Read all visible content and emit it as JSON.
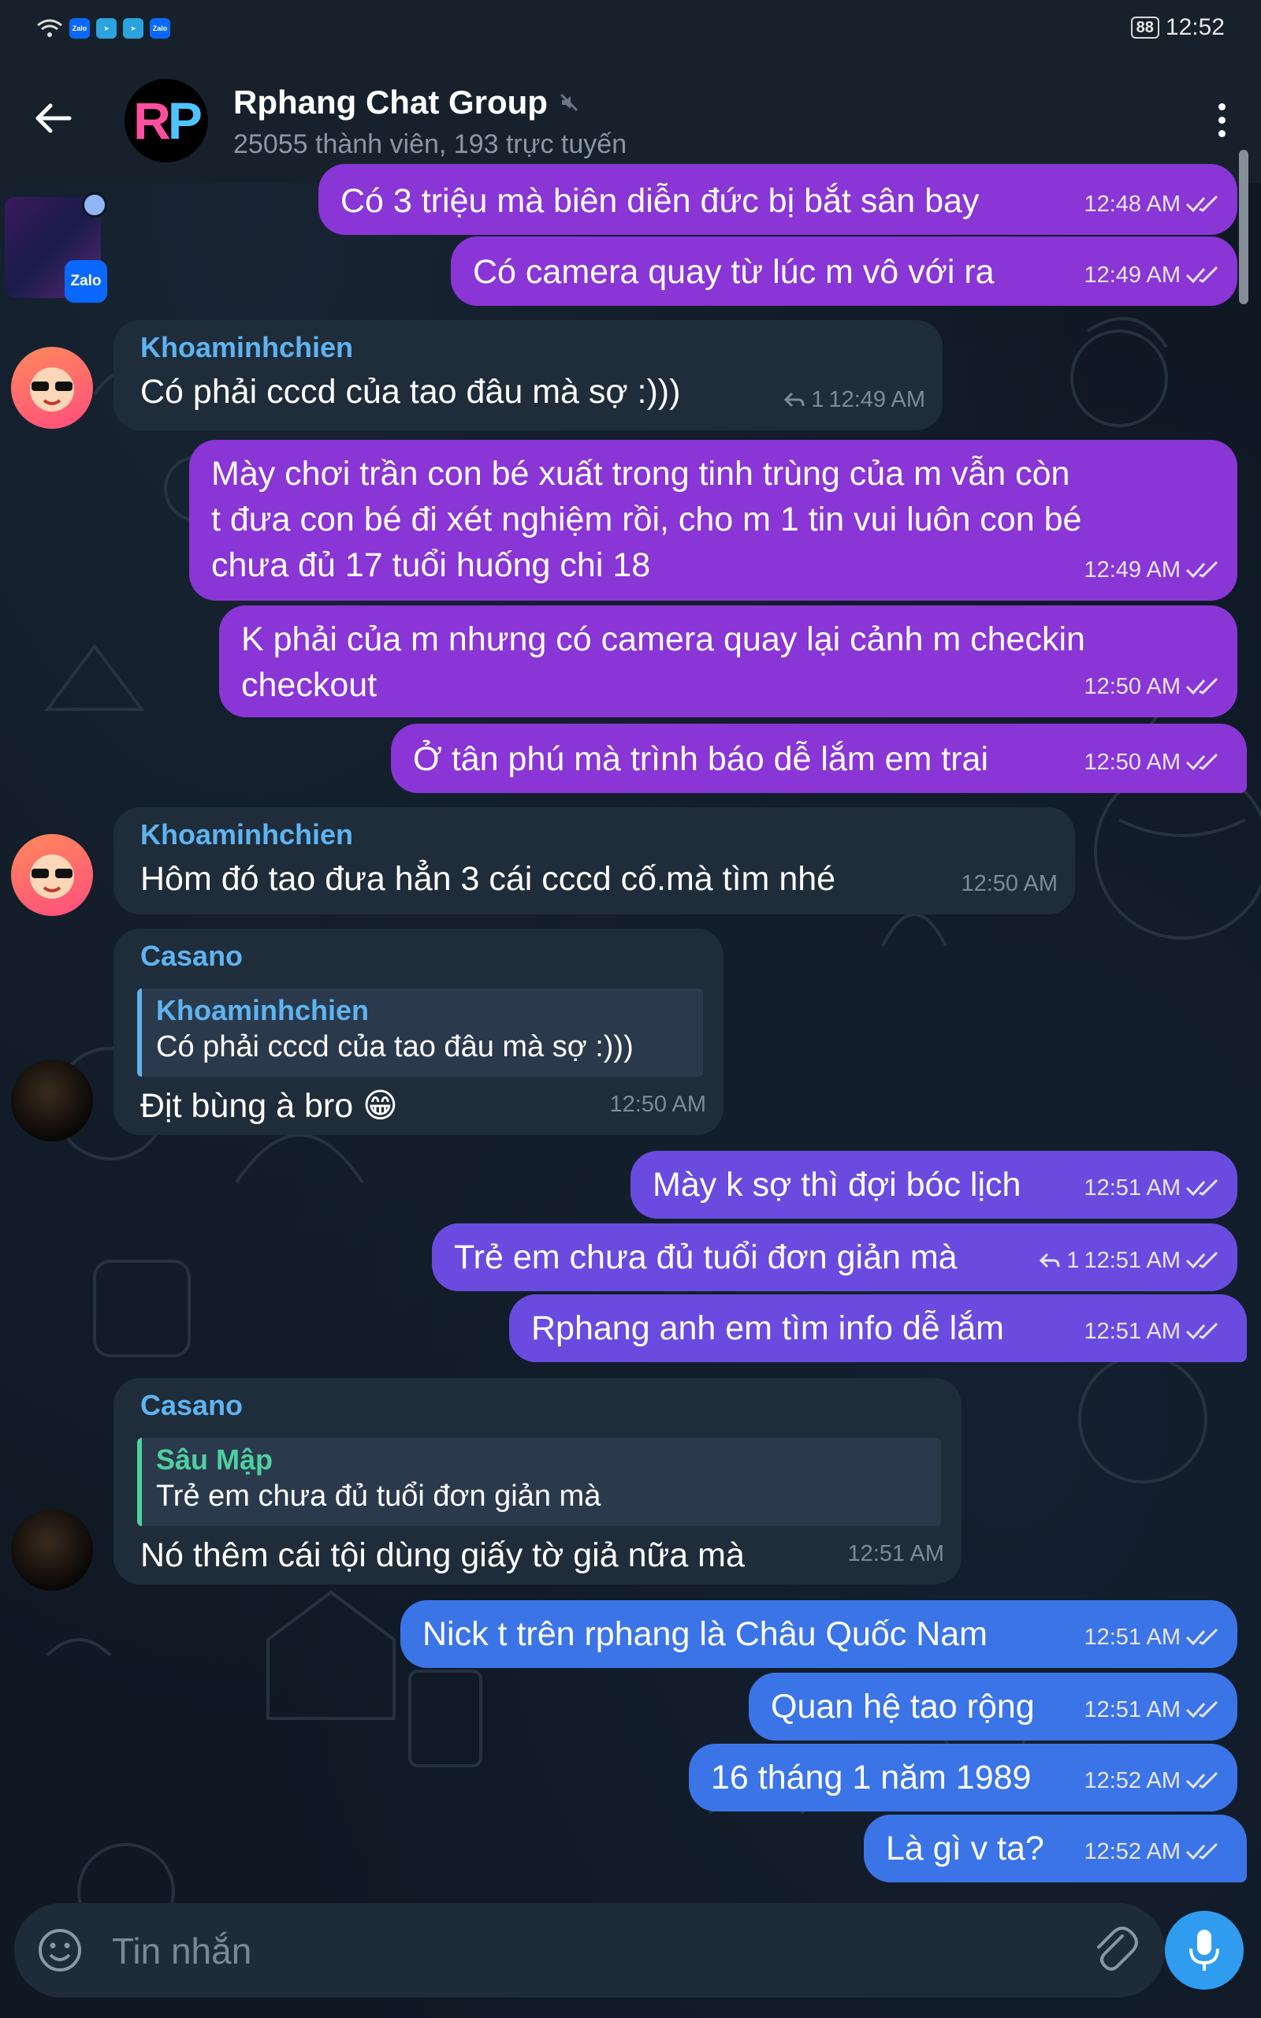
{
  "status_bar": {
    "time": "12:52",
    "battery": "88",
    "apps": [
      "Zalo",
      "Zalo"
    ]
  },
  "header": {
    "avatar_text_1": "R",
    "avatar_text_2": "P",
    "title": "Rphang Chat Group",
    "subtitle": "25055 thành viên, 193 trực tuyến"
  },
  "overlay": {
    "zalo_label": "Zalo"
  },
  "messages": {
    "m1": {
      "text": "Có 3 triệu mà biên diễn đức bị bắt sân bay",
      "time": "12:48 AM"
    },
    "m2": {
      "text": "Có camera quay từ lúc m vô với ra",
      "time": "12:49 AM"
    },
    "m3": {
      "sender": "Khoaminhchien",
      "text": "Có phải cccd của tao đâu mà sợ :)))",
      "replies": "1",
      "time": "12:49 AM"
    },
    "m4": {
      "text": "Mày chơi trần con bé xuất trong tinh trùng của m vẫn còn\nt đưa con bé đi xét nghiệm rồi, cho m 1 tin vui luôn con bé\nchưa đủ 17 tuổi huống chi 18",
      "time": "12:49 AM"
    },
    "m5": {
      "text": "K phải của m nhưng có camera quay lại cảnh m checkin\ncheckout",
      "time": "12:50 AM"
    },
    "m6": {
      "text": "Ở tân phú mà trình báo dễ lắm em trai",
      "time": "12:50 AM"
    },
    "m7": {
      "sender": "Khoaminhchien",
      "text": "Hôm đó tao đưa hẳn 3 cái cccd cố.mà tìm nhé",
      "time": "12:50 AM"
    },
    "m8": {
      "sender": "Casano",
      "reply_name": "Khoaminhchien",
      "reply_text": "Có phải cccd của tao đâu mà sợ :)))",
      "text": "Địt bùng à bro 😁",
      "time": "12:50 AM"
    },
    "m9": {
      "text": "Mày k sợ thì đợi bóc lịch",
      "time": "12:51 AM"
    },
    "m10": {
      "text": "Trẻ em chưa đủ tuổi đơn giản mà",
      "replies": "1",
      "time": "12:51 AM"
    },
    "m11": {
      "text": "Rphang anh em tìm info dễ lắm",
      "time": "12:51 AM"
    },
    "m12": {
      "sender": "Casano",
      "reply_name": "Sâu Mập",
      "reply_text": "Trẻ em chưa đủ tuổi đơn giản mà",
      "text": "Nó thêm cái tội dùng giấy tờ giả nữa mà",
      "time": "12:51 AM"
    },
    "m13": {
      "text": "Nick t trên rphang là Châu Quốc Nam",
      "time": "12:51 AM"
    },
    "m14": {
      "text": "Quan hệ tao rộng",
      "time": "12:51 AM"
    },
    "m15": {
      "text": "16 tháng 1 năm 1989",
      "time": "12:52 AM"
    },
    "m16": {
      "text": "Là gì v ta?",
      "time": "12:52 AM"
    }
  },
  "input": {
    "placeholder": "Tin nhắn"
  },
  "colors": {
    "outgoing_purple": "#8a35d6",
    "outgoing_violet": "#6a4be0",
    "outgoing_blue": "#3b74e6",
    "incoming": "#1f2c3a",
    "accent": "#2f9cf0"
  },
  "icons": [
    "back-arrow-icon",
    "muted-icon",
    "more-vert-icon",
    "double-check-icon",
    "reply-icon",
    "emoji-icon",
    "attach-icon",
    "mic-icon"
  ]
}
